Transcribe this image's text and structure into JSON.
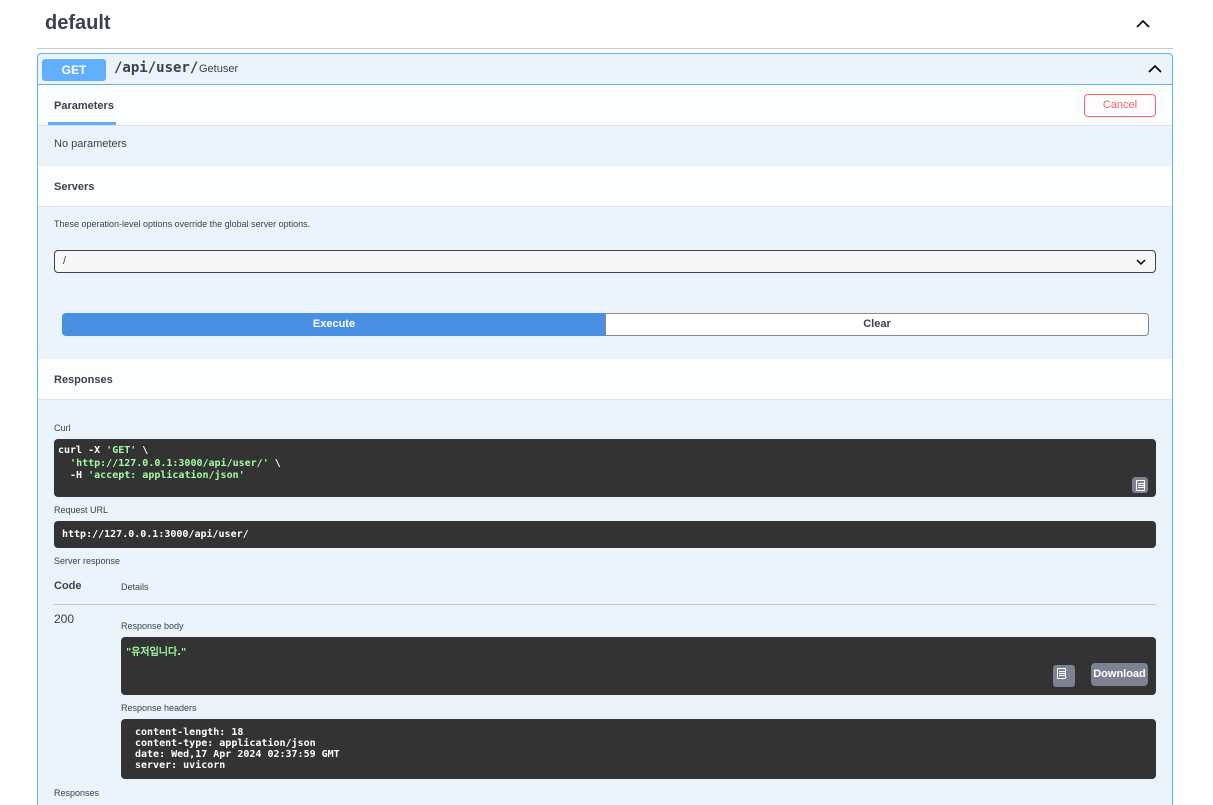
{
  "tag": {
    "title": "default"
  },
  "operation": {
    "method": "GET",
    "path": "/api/user/",
    "summary": "Getuser"
  },
  "parameters": {
    "tab_label": "Parameters",
    "cancel_label": "Cancel",
    "empty_text": "No parameters"
  },
  "servers": {
    "title": "Servers",
    "description": "These operation-level options override the global server options.",
    "selected": "/"
  },
  "actions": {
    "execute_label": "Execute",
    "clear_label": "Clear"
  },
  "responses": {
    "title": "Responses",
    "curl_label": "Curl",
    "curl_lines": [
      {
        "prefix": "curl -X ",
        "str": "'GET'",
        "suffix": " \\"
      },
      {
        "prefix": "  ",
        "str": "'http://127.0.0.1:3000/api/user/'",
        "suffix": " \\"
      },
      {
        "prefix": "  -H ",
        "str": "'accept: application/json'",
        "suffix": ""
      }
    ],
    "request_url_label": "Request URL",
    "request_url": "http://127.0.0.1:3000/api/user/",
    "server_response_label": "Server response",
    "code_header": "Code",
    "details_header": "Details",
    "code": "200",
    "body_label": "Response body",
    "body": "\"유저입니다.\"",
    "download_label": "Download",
    "headers_label": "Response headers",
    "headers": [
      "content-length: 18",
      "content-type: application/json",
      "date: Wed,17 Apr 2024 02:37:59 GMT",
      "server: uvicorn"
    ],
    "bottom_label": "Responses"
  },
  "colors": {
    "get_accent": "#61affe",
    "execute": "#4990e2",
    "cancel": "#ff6060",
    "code_bg": "#333333",
    "string": "#a2fca2"
  },
  "icons": [
    "chevron-up-icon",
    "chevron-down-icon",
    "copy-icon"
  ]
}
